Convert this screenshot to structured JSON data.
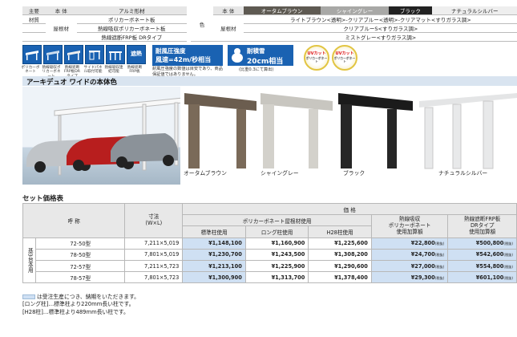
{
  "spec_left": {
    "col_head": "本 体",
    "row1_label": "主要",
    "row2_label": "材質",
    "body_value": "アルミ形材",
    "roof_label": "屋根材",
    "roof_values": [
      "ポリカーボネート板",
      "熱線吸収ポリカーボネート板",
      "熱線遮断FRP板 DRタイプ"
    ]
  },
  "spec_right": {
    "color_label": "色",
    "body_label": "本 体",
    "roof_label": "屋根材",
    "colors": [
      "オータムブラウン",
      "シャイングレー",
      "ブラック",
      "ナチュラルシルバー"
    ],
    "roof_rows": [
      "ライトブラウン<透明>-クリアブルー<透明>-クリアマット<すりガラス調>",
      "クリアブルーS<すりガラス調>",
      "ミストグレー<すりガラス調>"
    ]
  },
  "badges": {
    "items": [
      {
        "icon": "roof-poly-icon",
        "caption": "ポリカーボネート"
      },
      {
        "icon": "roof-heat-poly-icon",
        "caption": "熱線吸収ポリカーボネート"
      },
      {
        "icon": "roof-frp-icon",
        "caption": "熱線遮断FRP板DRタイプ"
      },
      {
        "icon": "side-panel-icon",
        "caption": "サイドパネル取付可能"
      },
      {
        "icon": "frame-icon",
        "caption": "熱線吸収連結可能"
      }
    ],
    "shade_text": "遮熱",
    "shade_caption": "熱線遮断FRP板"
  },
  "wind": {
    "line1": "耐風圧強度",
    "line2": "風速=42m/秒相当",
    "note": "耐風圧強度の数値は目安であり、商品保証値ではありません。"
  },
  "snow": {
    "line1": "耐積雪",
    "line2": "20cm相当",
    "note": "(比重0.3にて算出)"
  },
  "uv": {
    "badge1": "UVカット",
    "badge2": "UVカット",
    "sub": "ポリカーボネート"
  },
  "section": {
    "title": "アーキデュオ ワイドの本体色",
    "variants": [
      "オータムブラウン",
      "シャイングレー",
      "ブラック",
      "ナチュラルシルバー"
    ]
  },
  "price": {
    "title": "セット価格表",
    "head": {
      "name": "呼 称",
      "size": "寸法\n(W×L)",
      "price": "価 格",
      "poly": "ポリカーボネート屋根材使用",
      "heat": "熱線吸収\nポリカーボネート\n使用加算額",
      "frp": "熱線遮断FRP板\nDRタイプ\n使用加算額",
      "standard": "標準柱使用",
      "long": "ロング柱使用",
      "h28": "H28柱使用"
    },
    "group_label": "基3台本用",
    "rows": [
      {
        "name": "72-50型",
        "size": "7,211×5,019",
        "standard": "¥1,148,100",
        "long": "¥1,160,900",
        "h28": "¥1,225,600",
        "heat": "¥22,800",
        "frp": "¥500,800"
      },
      {
        "name": "78-50型",
        "size": "7,801×5,019",
        "standard": "¥1,230,700",
        "long": "¥1,243,500",
        "h28": "¥1,308,200",
        "heat": "¥24,700",
        "frp": "¥542,600"
      },
      {
        "name": "72-57型",
        "size": "7,211×5,723",
        "standard": "¥1,213,100",
        "long": "¥1,225,900",
        "h28": "¥1,290,600",
        "heat": "¥27,000",
        "frp": "¥554,800"
      },
      {
        "name": "78-57型",
        "size": "7,801×5,723",
        "standard": "¥1,300,900",
        "long": "¥1,313,700",
        "h28": "¥1,378,400",
        "heat": "¥29,300",
        "frp": "¥601,100"
      }
    ],
    "tax_mark": "(税抜)"
  },
  "notes": [
    "は受注生産につき、納期をいただきます。",
    "[ロング柱]…標準柱より220mm長い柱です。",
    "[H28柱]…標準柱より489mm長い柱です。"
  ]
}
